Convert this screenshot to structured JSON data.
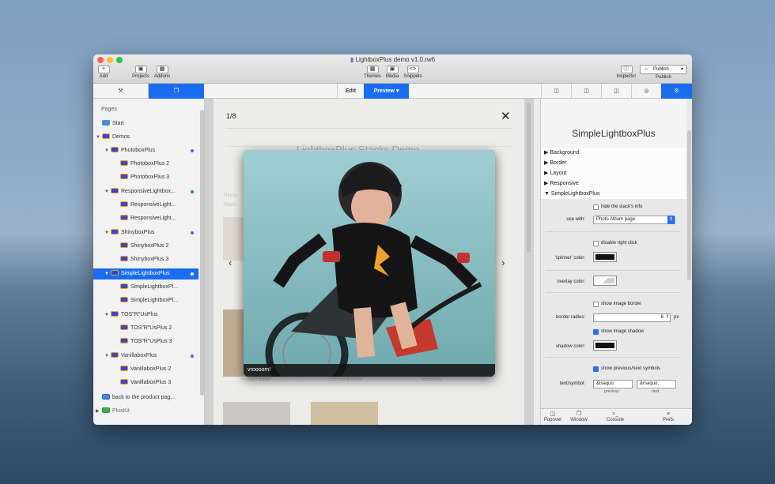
{
  "window": {
    "title": "LightboxPlus demo v1.0.rw6"
  },
  "toolbar": {
    "add": "Add",
    "projects": "Projects",
    "addons": "Addons",
    "themes": "Themes",
    "media": "Media",
    "snippets": "Snippets",
    "inspector": "Inspector",
    "publish_button": "Publish",
    "publish": "Publish"
  },
  "tabs": {
    "edit": "Edit",
    "preview": "Preview"
  },
  "sidebar": {
    "header": "Pages",
    "start": "Start",
    "demos": "Demos",
    "items": [
      "PhotoboxPlus",
      "PhotoboxPlus 2",
      "PhotoboxPlus 3",
      "ResponsiveLightbox...",
      "ResponsiveLight...",
      "ResponsiveLight...",
      "ShinyboxPlus",
      "ShinyboxPlus 2",
      "ShinyboxPlus 3",
      "SimpleLightboxPlus",
      "SimpleLightboxPl...",
      "SimpleLightboxPl...",
      "TOS\"R\"UsPlus",
      "TOS\"R\"UsPlus 2",
      "TOS\"R\"UsPlus 3",
      "VanillaboxPlus",
      "VanillaboxPlus 2",
      "VanillaboxPlus 3"
    ],
    "back": "back to the product pag...",
    "pluskit": "PlusKit"
  },
  "preview": {
    "counter": "1/8",
    "page_title": "LightboxPlus Stacks Demo",
    "intro_line1": "This is",
    "intro_line2": "That's",
    "caption": "vroooom!",
    "under1": "modern bicker",
    "under2": "nice companion",
    "under3": "tomorrow"
  },
  "inspector": {
    "title": "SimpleLightboxPlus",
    "sections": [
      "Background",
      "Border",
      "Layout",
      "Responsive",
      "SimpleLightboxPlus"
    ],
    "hide_info": "hide the stack's info",
    "use_with_label": "use with:",
    "use_with_value": "Photo Album page",
    "disable_right_click": "disable right click",
    "spinner_color": "'spinner' color:",
    "overlay_color": "overlay color:",
    "show_image_border": "show image border",
    "border_radius_label": "border radius:",
    "border_radius_value": "6",
    "border_radius_unit": "px",
    "show_image_shadow": "show image shadow",
    "shadow_color": "shadow color:",
    "show_prev_next": "show previous/next symbols",
    "text_symbol_label": "text/symbol:",
    "previous_value": "&lsaquo;",
    "next_value": "&rsaquo;",
    "previous_caption": "previous",
    "next_caption": "next",
    "checkbox_states": {
      "hide_info": false,
      "disable_right_click": false,
      "show_image_border": false,
      "show_image_shadow": true,
      "show_prev_next": true
    },
    "colors": {
      "spinner": "#111111",
      "overlay": "#cfcfcf",
      "shadow": "#111111"
    }
  },
  "bottombar": {
    "popover": "Popover",
    "window": "Window",
    "console": "Console",
    "prefs": "Prefs"
  },
  "colors": {
    "accent": "#1a6cf0"
  }
}
